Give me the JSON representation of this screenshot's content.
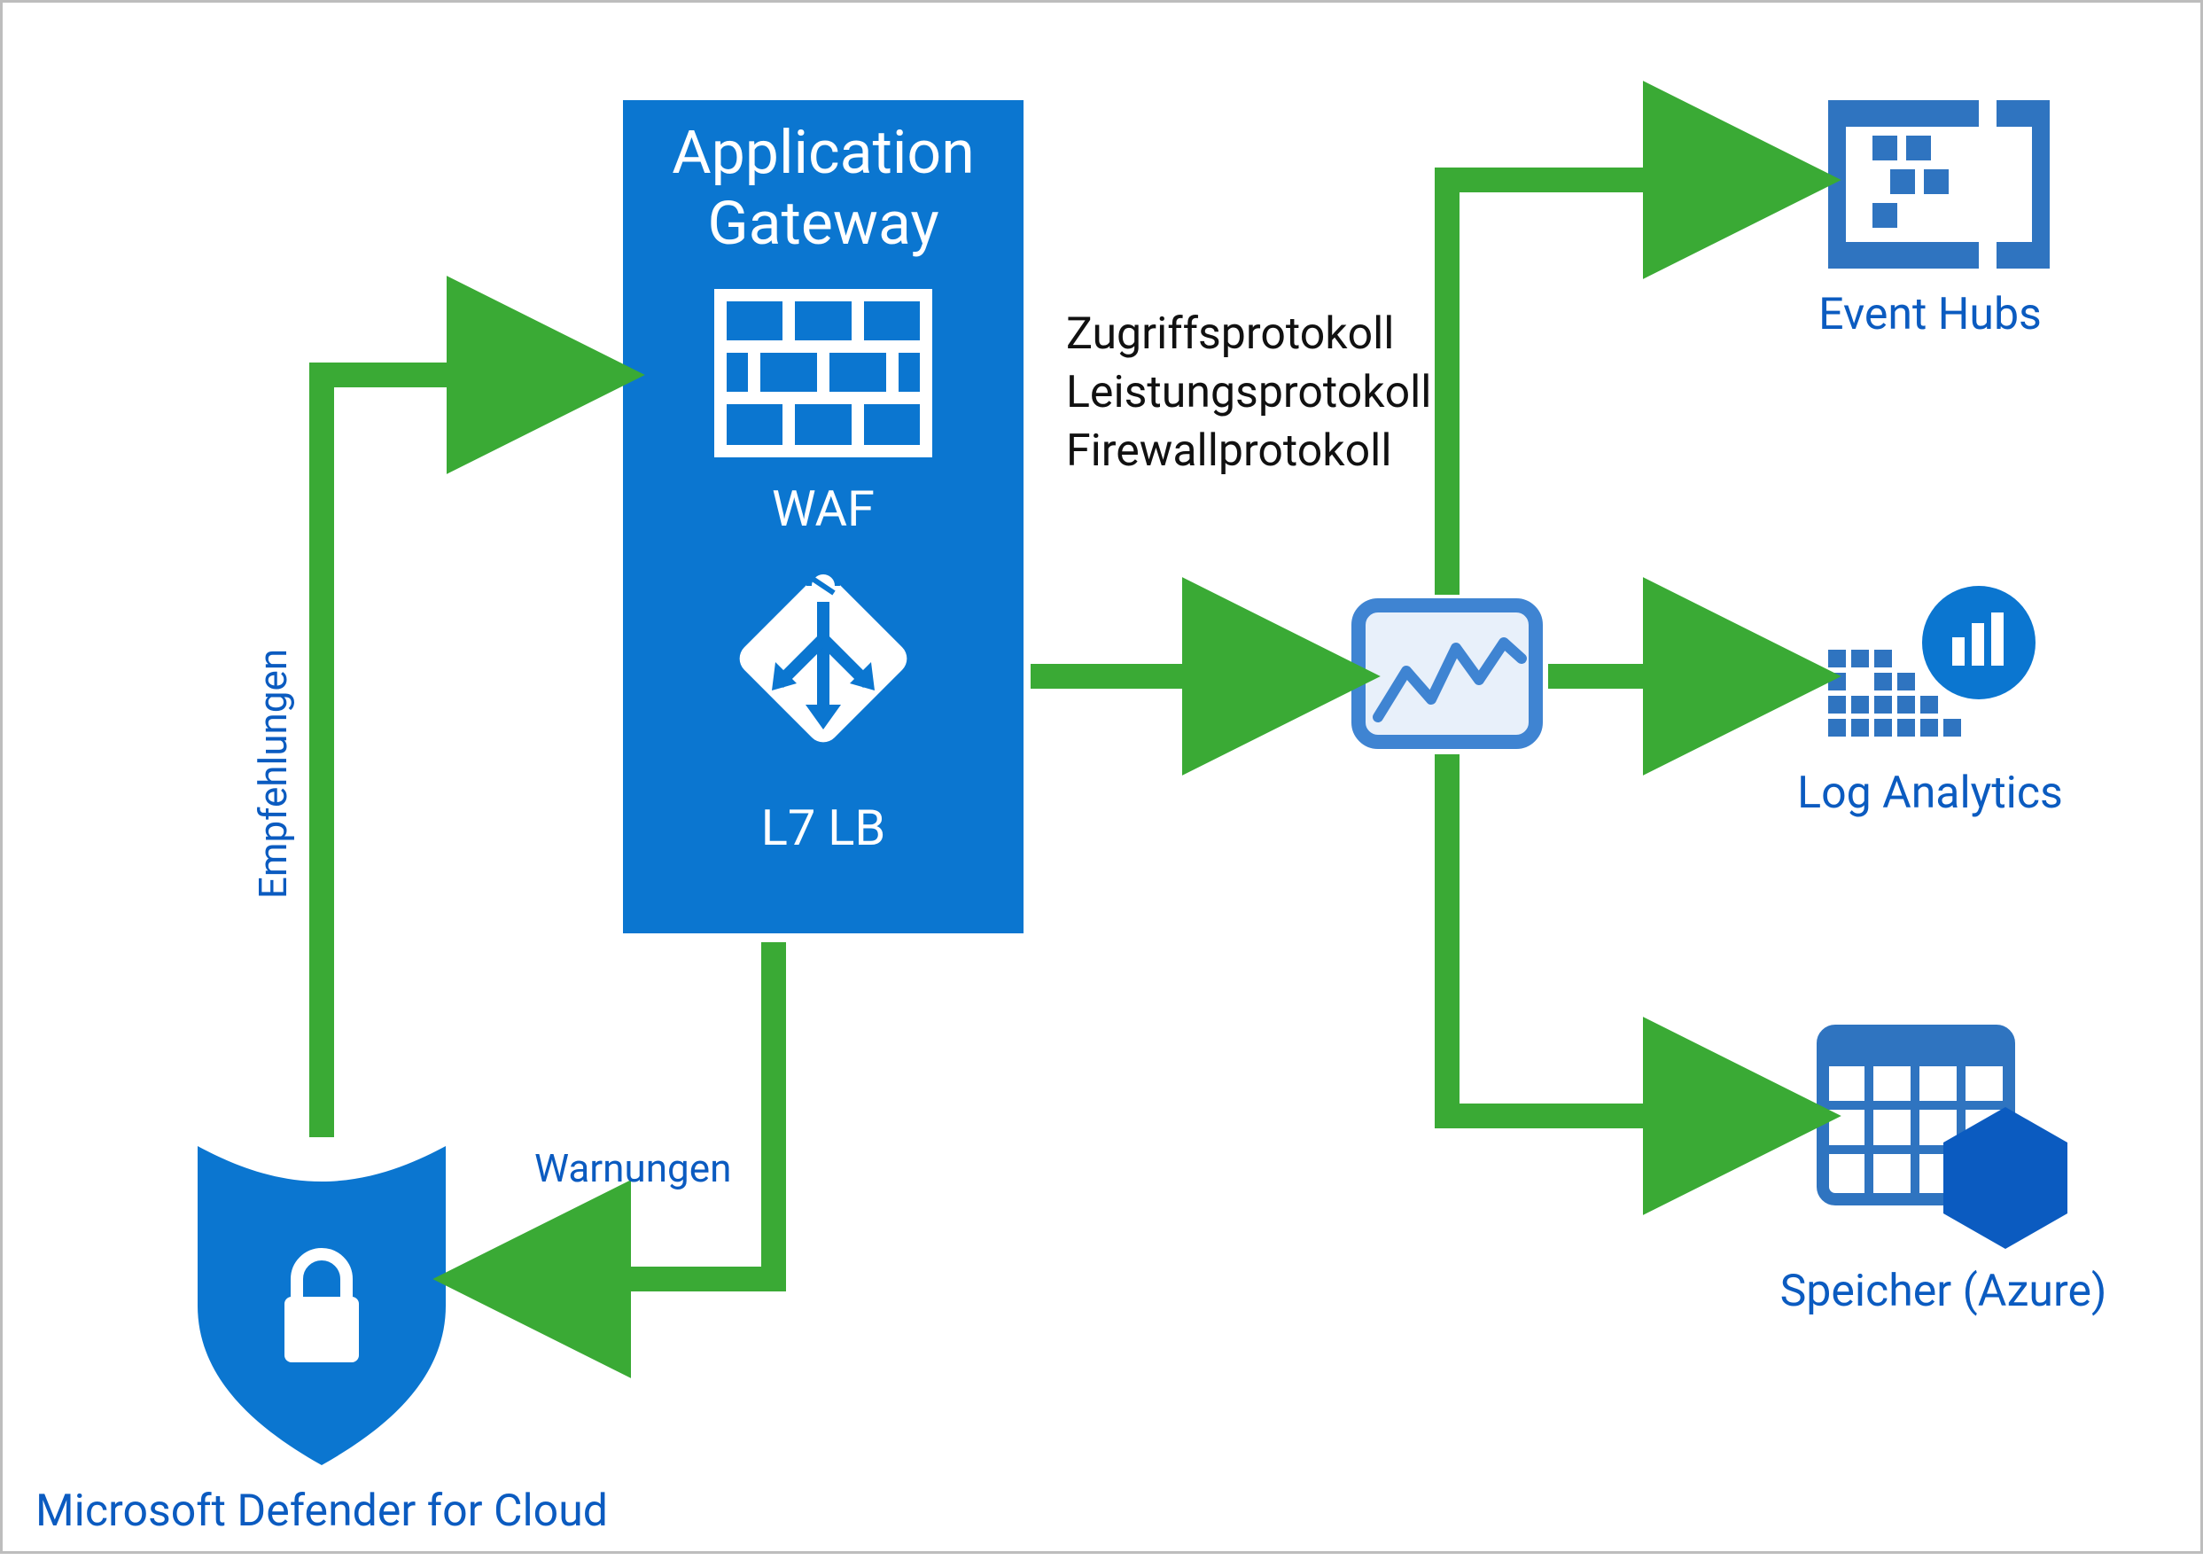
{
  "nodes": {
    "appGateway": {
      "title1": "Application",
      "title2": "Gateway",
      "waf": "WAF",
      "l7lb": "L7 LB"
    },
    "defender": {
      "label": "Microsoft Defender for Cloud"
    },
    "eventHubs": {
      "label": "Event Hubs"
    },
    "logAnalytics": {
      "label": "Log Analytics"
    },
    "storage": {
      "label": "Speicher (Azure)"
    }
  },
  "edges": {
    "recommendations": "Empfehlungen",
    "alerts": "Warnungen",
    "logs": {
      "line1": "Zugriffsprotokoll",
      "line2": "Leistungsprotokoll",
      "line3": "Firewallprotokoll"
    }
  },
  "colors": {
    "azureBlue": "#0b5bc0",
    "boxFill": "#0b76d0",
    "arrowGreen": "#3aaa35",
    "iconBlue": "#2f74c0",
    "iconFill": "#e8f0fa"
  }
}
